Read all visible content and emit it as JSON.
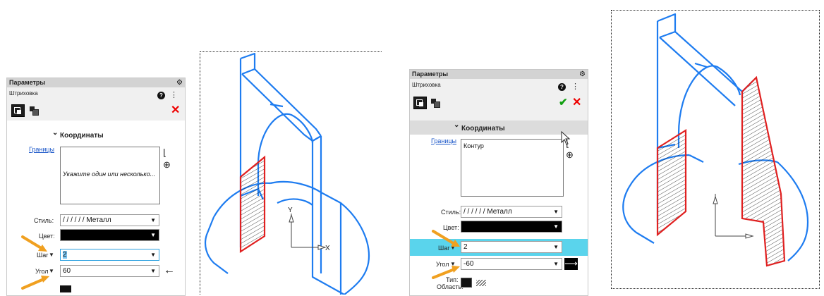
{
  "left_panel": {
    "title": "Параметры",
    "subtitle": "Штриховка",
    "section": "Координаты",
    "link": "Границы",
    "boundary_text": "Укажите один или несколько...",
    "style_label": "Стиль:",
    "style_value": "/ / / / / / Металл",
    "color_label": "Цвет:",
    "step_label": "Шаг",
    "step_value": "2",
    "angle_label": "Угол",
    "angle_value": "60",
    "angle_arrow": "←"
  },
  "right_panel": {
    "title": "Параметры",
    "subtitle": "Штриховка",
    "section": "Координаты",
    "link": "Границы",
    "boundary_text": "Контур",
    "style_label": "Стиль:",
    "style_value": "/ / / / / / Металл",
    "color_label": "Цвет:",
    "step_label": "Шаг",
    "step_value": "2",
    "angle_label": "Угол",
    "angle_value": "-60",
    "angle_arrow": "⟶",
    "type_label": "Тип:",
    "area_label": "Область:"
  },
  "icons": {
    "gear": "⚙",
    "help": "?",
    "tree": "⋮",
    "close": "✕",
    "ok": "✔",
    "dropdown": "▼",
    "section_toggle": "⌄"
  },
  "colors": {
    "outline": "#1e7cf0",
    "hatch_border": "#e02020",
    "highlight": "#5ad4ec",
    "arrow_marker": "#f0a020"
  },
  "drawing1": {
    "axis_x": "X",
    "axis_y": "Y"
  }
}
